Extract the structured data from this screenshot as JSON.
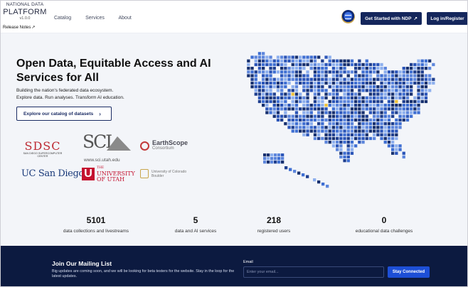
{
  "header": {
    "logo_line1": "NATIONAL DATA",
    "logo_line2": "PLATFORM",
    "version": "v1.0.0",
    "release_notes": "Release Notes",
    "nav": [
      "Catalog",
      "Services",
      "About"
    ],
    "get_started": "Get Started with NDP",
    "login": "Log in/Register"
  },
  "hero": {
    "title": "Open Data, Equitable Access and AI Services for All",
    "subtitle_line1": "Building the nation's federated data ecosystem.",
    "subtitle_line2": "Explore data. Run analyses. Transform AI education.",
    "explore_button": "Explore our catalog of datasets"
  },
  "partners": {
    "sdsc_main": "SDSC",
    "sdsc_sub": "SAN DIEGO SUPERCOMPUTER CENTER",
    "sci_main": "SCI",
    "sci_url": "www.sci.utah.edu",
    "earthscope_1": "EarthScope",
    "earthscope_2": "Consortium",
    "ucsd": "UC San Diego",
    "utah_the": "THE",
    "utah_univ": "UNIVERSITY",
    "utah_of": "OF UTAH",
    "cu_1": "University of Colorado",
    "cu_2": "Boulder"
  },
  "stats": [
    {
      "number": "5101",
      "label": "data collections and livestreams"
    },
    {
      "number": "5",
      "label": "data and AI services"
    },
    {
      "number": "218",
      "label": "registered users"
    },
    {
      "number": "0",
      "label": "educational data challenges"
    }
  ],
  "mailing": {
    "heading": "Join Our Mailing List",
    "description": "Big updates are coming soon, and we will be looking for beta testers for the website. Stay in the loop for the latest updates.",
    "email_label": "Email",
    "email_placeholder": "Enter your email...",
    "submit": "Stay Connected"
  },
  "colors": {
    "primary": "#15275c",
    "footer": "#0c1a40",
    "cta": "#1d4fd6",
    "map_tile_dark": "#1f3f8f",
    "map_tile_mid": "#3f6fd2",
    "map_tile_light": "#8eb0ee",
    "map_accent": "#f0c23a"
  }
}
